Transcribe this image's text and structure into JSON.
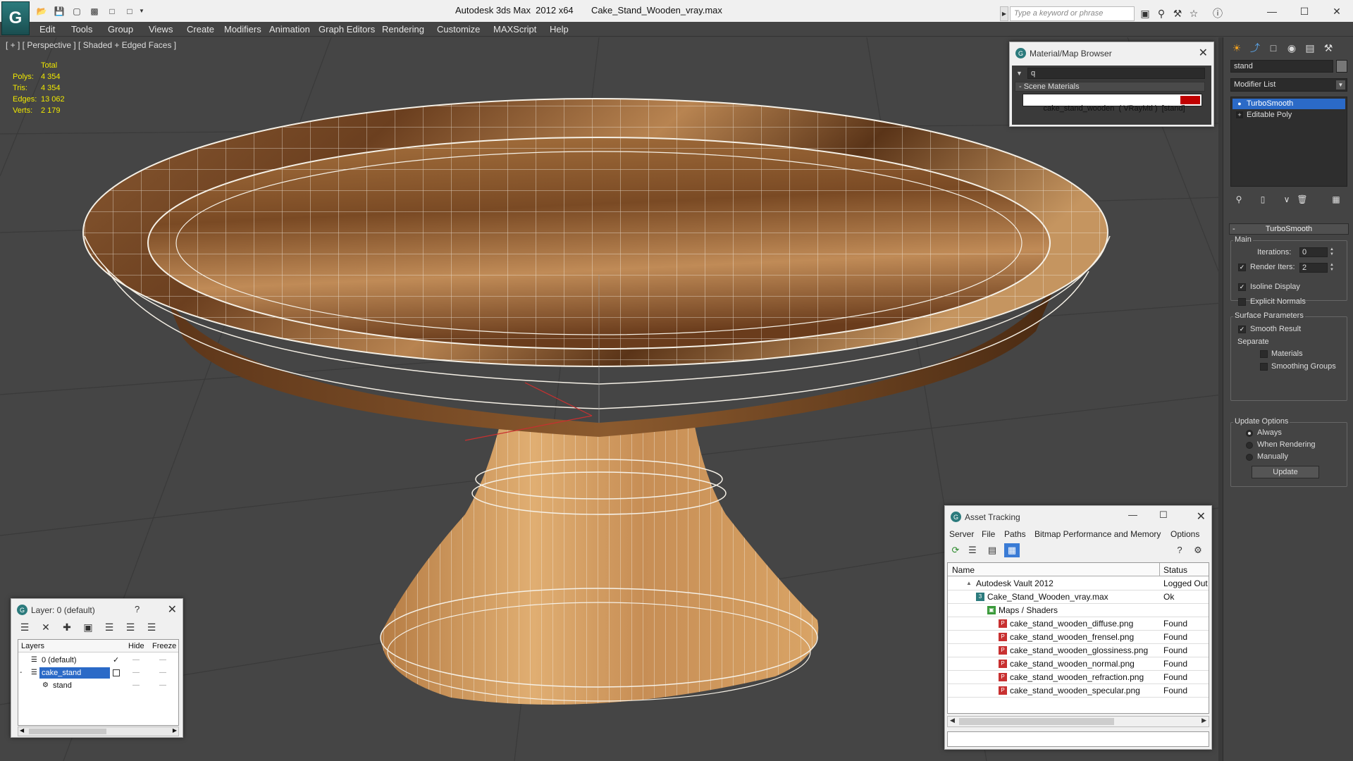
{
  "titlebar": {
    "app_logo": "G",
    "title": "Autodesk 3ds Max  2012 x64       Cake_Stand_Wooden_vray.max",
    "search_placeholder": "Type a keyword or phrase",
    "quick_access": [
      "open-icon",
      "save-icon",
      "new-icon",
      "undo-icon",
      "redo-icon",
      "dropdown-icon"
    ]
  },
  "menu": [
    "Edit",
    "Tools",
    "Group",
    "Views",
    "Create",
    "Modifiers",
    "Animation",
    "Graph Editors",
    "Rendering",
    "Customize",
    "MAXScript",
    "Help"
  ],
  "viewport": {
    "label": "[ + ] [ Perspective ] [ Shaded + Edged Faces ]",
    "stats": {
      "header": "Total",
      "rows": [
        {
          "label": "Polys:",
          "value": "4 354"
        },
        {
          "label": "Tris:",
          "value": "4 354"
        },
        {
          "label": "Edges:",
          "value": "13 062"
        },
        {
          "label": "Verts:",
          "value": "2 179"
        }
      ]
    }
  },
  "material_browser": {
    "title": "Material/Map Browser",
    "search_value": "q",
    "section": "- Scene Materials",
    "item": "cake_stand_wooden  ( VRayMtl )  [stand]",
    "swatch_color": "#c00000"
  },
  "command_panel": {
    "object_name": "stand",
    "modifier_list": "Modifier List",
    "stack": [
      {
        "label": "TurboSmooth",
        "selected": true
      },
      {
        "label": "Editable Poly",
        "selected": false
      }
    ],
    "rollout_title": "TurboSmooth",
    "main_group": "Main",
    "iterations_label": "Iterations:",
    "iterations_value": "0",
    "render_iters_label": "Render Iters:",
    "render_iters_value": "2",
    "isoline_label": "Isoline Display",
    "explicit_normals_label": "Explicit Normals",
    "surface_group": "Surface Parameters",
    "smooth_result_label": "Smooth Result",
    "separate_label": "Separate",
    "materials_label": "Materials",
    "smoothing_groups_label": "Smoothing Groups",
    "update_group": "Update Options",
    "always_label": "Always",
    "when_rendering_label": "When Rendering",
    "manually_label": "Manually",
    "update_button": "Update"
  },
  "layer_panel": {
    "title": "Layer: 0 (default)",
    "help": "?",
    "columns": {
      "layers": "Layers",
      "hide": "Hide",
      "freeze": "Freeze"
    },
    "rows": [
      {
        "name": "0 (default)",
        "selected": false,
        "indent": 1
      },
      {
        "name": "cake_stand",
        "selected": true,
        "indent": 1
      },
      {
        "name": "stand",
        "selected": false,
        "indent": 2
      }
    ]
  },
  "asset_tracking": {
    "title": "Asset Tracking",
    "menu": [
      "Server",
      "File",
      "Paths",
      "Bitmap Performance and Memory",
      "Options"
    ],
    "columns": {
      "name": "Name",
      "status": "Status"
    },
    "rows": [
      {
        "name": "Autodesk Vault 2012",
        "status": "Logged Out",
        "indent": 0
      },
      {
        "name": "Cake_Stand_Wooden_vray.max",
        "status": "Ok",
        "indent": 1
      },
      {
        "name": "Maps / Shaders",
        "status": "",
        "indent": 2
      },
      {
        "name": "cake_stand_wooden_diffuse.png",
        "status": "Found",
        "indent": 3
      },
      {
        "name": "cake_stand_wooden_frensel.png",
        "status": "Found",
        "indent": 3
      },
      {
        "name": "cake_stand_wooden_glossiness.png",
        "status": "Found",
        "indent": 3
      },
      {
        "name": "cake_stand_wooden_normal.png",
        "status": "Found",
        "indent": 3
      },
      {
        "name": "cake_stand_wooden_refraction.png",
        "status": "Found",
        "indent": 3
      },
      {
        "name": "cake_stand_wooden_specular.png",
        "status": "Found",
        "indent": 3
      }
    ]
  }
}
